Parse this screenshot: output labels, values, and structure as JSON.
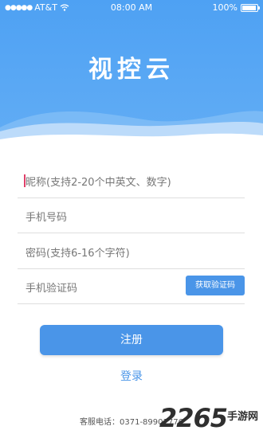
{
  "status_bar": {
    "carrier": "AT&T",
    "time": "08:00 AM",
    "battery": "100%",
    "battery_level": 1.0
  },
  "app": {
    "logo_text": "视控云"
  },
  "form": {
    "nickname_placeholder": "昵称(支持2-20个中英文、数字)",
    "phone_placeholder": "手机号码",
    "password_placeholder": "密码(支持6-16个字符)",
    "code_placeholder": "手机验证码",
    "get_code_label": "获取验证码"
  },
  "actions": {
    "register_label": "注册",
    "login_label": "登录"
  },
  "footer": {
    "service_phone": "客服电话：0371-89901776"
  },
  "watermark": {
    "number": "2265",
    "site": "手游网"
  },
  "colors": {
    "primary": "#4a95e8",
    "header": "#4ea1f3"
  }
}
